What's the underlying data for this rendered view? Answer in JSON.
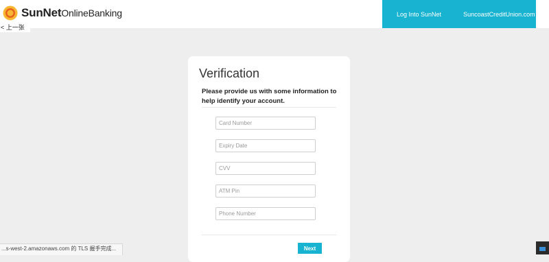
{
  "header": {
    "logo": {
      "name_bold": "SunNet",
      "name_light": "OnlineBanking"
    },
    "nav": {
      "login_label": "Log Into SunNet",
      "site_label": "SuncoastCreditUnion.com"
    },
    "back_label": "< 上一张"
  },
  "card": {
    "title": "Verification",
    "description": "Please provide us with some information to help identify your account.",
    "fields": {
      "card_number": "Card Number",
      "expiry_date": "Expiry Date",
      "cvv": "CVV",
      "atm_pin": "ATM Pin",
      "phone_number": "Phone Number"
    },
    "next_label": "Next"
  },
  "status_bar": {
    "text": "...s-west-2.amazonaws.com 的 TLS 握手完成..."
  },
  "colors": {
    "accent": "#17b3d0",
    "background": "#eeeeee",
    "logo_sun": "#f39c12"
  },
  "icons": [
    "sun-logo-icon",
    "corner-widget-icon"
  ]
}
